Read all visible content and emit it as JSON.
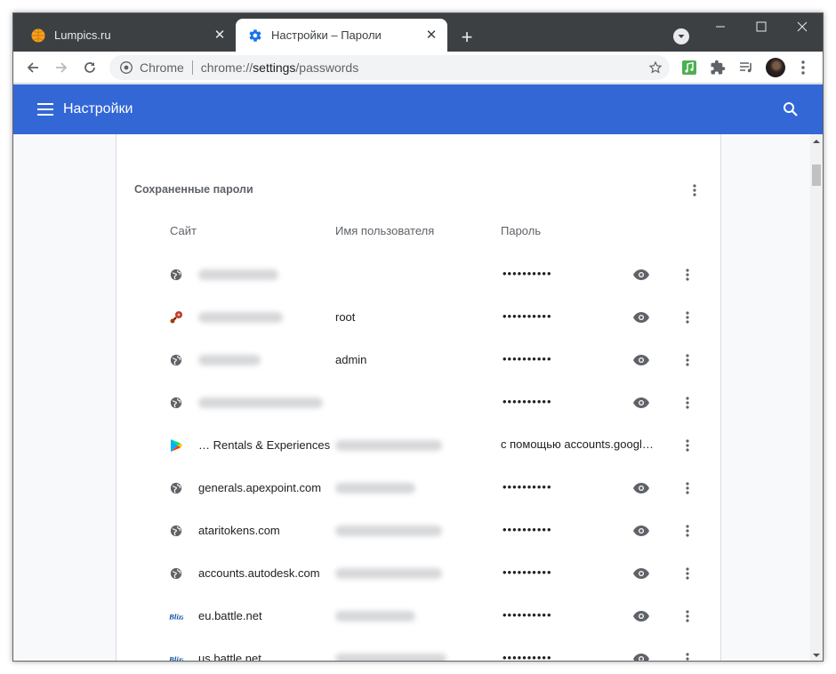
{
  "tabs": [
    {
      "title": "Lumpics.ru",
      "close": "✕"
    },
    {
      "title": "Настройки – Пароли",
      "close": "✕"
    }
  ],
  "new_tab": "+",
  "omnibox": {
    "scheme": "Chrome",
    "url_prefix": "chrome://",
    "url_host": "settings",
    "url_path": "/passwords"
  },
  "header": {
    "title": "Настройки"
  },
  "passwords": {
    "section_title": "Сохраненные пароли",
    "columns": {
      "site": "Сайт",
      "username": "Имя пользователя",
      "password": "Пароль"
    },
    "rows": [
      {
        "site": "",
        "username": "",
        "password": "••••••••••",
        "icon": "globe-icon"
      },
      {
        "site": "",
        "username": "root",
        "password": "••••••••••",
        "icon": "router-icon"
      },
      {
        "site": "",
        "username": "admin",
        "password": "••••••••••",
        "icon": "globe-icon"
      },
      {
        "site": "",
        "username": "",
        "password": "••••••••••",
        "icon": "globe-icon"
      },
      {
        "site": "… Rentals & Experiences",
        "username": "",
        "password": "с помощью accounts.googl…",
        "icon": "google-play-icon"
      },
      {
        "site": "generals.apexpoint.com",
        "username": "",
        "password": "••••••••••",
        "icon": "globe-icon"
      },
      {
        "site": "ataritokens.com",
        "username": "",
        "password": "••••••••••",
        "icon": "globe-icon"
      },
      {
        "site": "accounts.autodesk.com",
        "username": "",
        "password": "••••••••••",
        "icon": "globe-icon"
      },
      {
        "site": "eu.battle.net",
        "username": "",
        "password": "••••••••••",
        "icon": "blizzard-icon"
      },
      {
        "site": "us.battle.net",
        "username": "",
        "password": "••••••••••",
        "icon": "blizzard-icon"
      }
    ]
  },
  "colors": {
    "header_blue": "#3367d6",
    "tab_strip": "#3c4043"
  }
}
